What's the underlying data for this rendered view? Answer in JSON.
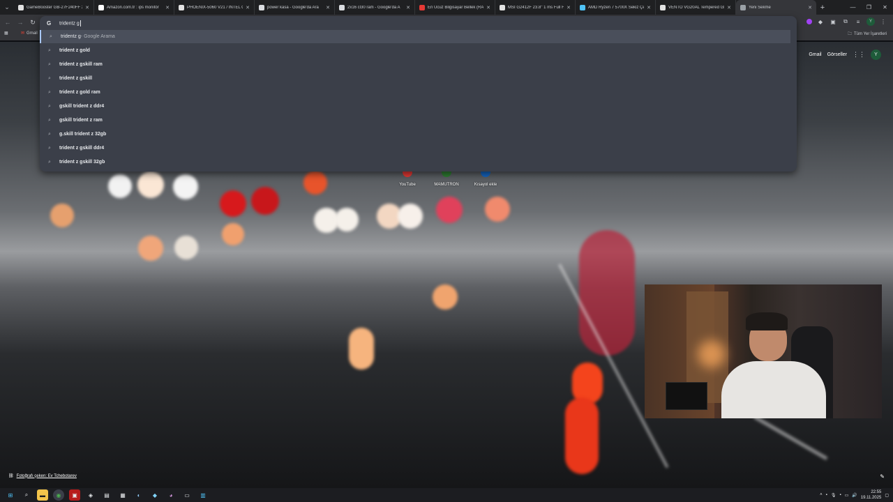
{
  "tabs": [
    {
      "title": "GameBooster GB-27F240FF 2",
      "fav": "#e2e2e2",
      "active": false
    },
    {
      "title": "Amazon.com.tr : ips monitör",
      "fav": "#ffffff",
      "active": false
    },
    {
      "title": "PHOENIX-5060 V21 / INTEL C",
      "fav": "#e2e2e2",
      "active": false
    },
    {
      "title": "power kasa - Google'da Ara",
      "fav": "#dadce0",
      "active": false
    },
    {
      "title": "2x16 cl30 ram - Google'da A",
      "fav": "#dadce0",
      "active": false
    },
    {
      "title": "En Ucuz Bilgisayar Bellek (RA",
      "fav": "#e53935",
      "active": false
    },
    {
      "title": "MSI G2412F 23.8\" 1 ms Full H",
      "fav": "#e2e2e2",
      "active": false
    },
    {
      "title": "AMD Ryzen 7 5700X Sekiz Çe",
      "fav": "#4fc3f7",
      "active": false
    },
    {
      "title": "VENTO VG20AL Tempered Gl",
      "fav": "#e2e2e2",
      "active": false
    },
    {
      "title": "Yeni Sekme",
      "fav": "#9aa0a6",
      "active": true
    }
  ],
  "omnibox": {
    "typed": "tridentz g",
    "suggestions": [
      {
        "typed": "tridentz g",
        "rest": " - Google Arama",
        "highlight": true,
        "bold_rest": false
      },
      {
        "typed": "trident z g",
        "rest": "old",
        "highlight": false,
        "bold_rest": true
      },
      {
        "typed": "trident z g",
        "rest": " skill ram",
        "highlight": false,
        "bold_rest": true
      },
      {
        "typed": "trident z g",
        "rest": "skill",
        "highlight": false,
        "bold_rest": true
      },
      {
        "typed": "trident z g",
        "rest": "old ram",
        "highlight": false,
        "bold_rest": true
      },
      {
        "typed": "g",
        "rest": " skill trident z ddr4",
        "highlight": false,
        "bold_rest": true
      },
      {
        "typed": "g",
        "rest": " skill trident z ram",
        "highlight": false,
        "bold_rest": true
      },
      {
        "typed": "g",
        "rest": ".skill trident z 32gb",
        "highlight": false,
        "bold_rest": true
      },
      {
        "typed": "trident z g",
        "rest": "skill ddr4",
        "highlight": false,
        "bold_rest": true
      },
      {
        "typed": "trident z g",
        "rest": "skill 32gb",
        "highlight": false,
        "bold_rest": true
      }
    ]
  },
  "bookmarks": {
    "gmail": "Gmail",
    "all_bookmarks": "Tüm Yer İşaretleri"
  },
  "ntp": {
    "gmail_link": "Gmail",
    "images_link": "Görseller",
    "avatar_letter": "Y",
    "shortcuts": [
      {
        "label": "YouTube",
        "color": "#e53935"
      },
      {
        "label": "MAMUTRON",
        "color": "#2e7d32"
      },
      {
        "label": "Kısayol ekle",
        "color": "#1565c0"
      }
    ],
    "photo_credit": "Fotoğrafı çeken: Ev Tchebotarev"
  },
  "taskbar": {
    "time": "22:55",
    "date": "19.11.2025"
  }
}
